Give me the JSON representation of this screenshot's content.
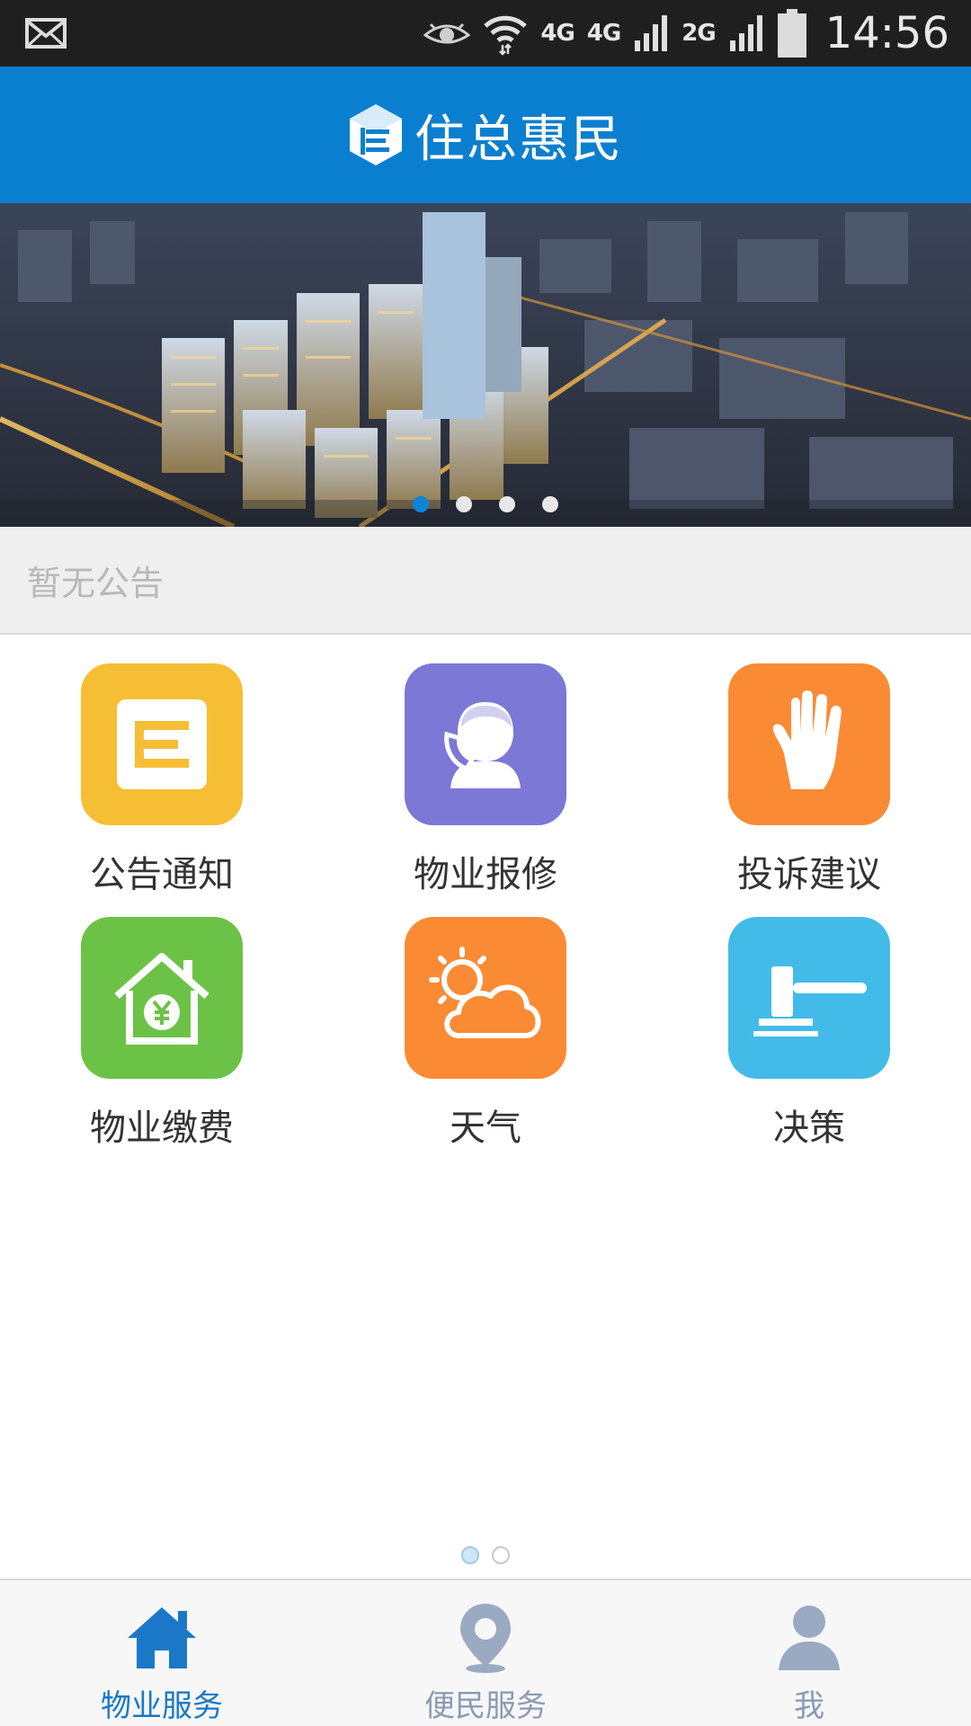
{
  "status_bar": {
    "mail_icon": "envelope-icon",
    "eye_icon": "eye-icon",
    "wifi_icon": "wifi-icon",
    "net_1": "4G",
    "net_2": "4G",
    "net_3": "2G",
    "time": "14:56"
  },
  "header": {
    "title": "住总惠民",
    "logo_icon": "cube-logo-icon",
    "background": "#0b7fcf"
  },
  "banner": {
    "image": "city-night-aerial-render",
    "dots_total": 4,
    "active_dot": 1
  },
  "notice": {
    "text": "暂无公告"
  },
  "services": [
    {
      "label": "公告通知",
      "icon": "notice-document-icon",
      "color": "#f6be35"
    },
    {
      "label": "物业报修",
      "icon": "phone-person-icon",
      "color": "#7b78d6"
    },
    {
      "label": "投诉建议",
      "icon": "raised-hand-icon",
      "color": "#fb8a35"
    },
    {
      "label": "物业缴费",
      "icon": "house-yuan-icon",
      "color": "#6cc246"
    },
    {
      "label": "天气",
      "icon": "sun-cloud-icon",
      "color": "#fb8a35"
    },
    {
      "label": "决策",
      "icon": "gavel-icon",
      "color": "#42bbe9"
    }
  ],
  "pager": {
    "total": 2,
    "active": 1
  },
  "bottom_nav": [
    {
      "label": "物业服务",
      "icon": "home-icon",
      "active": true
    },
    {
      "label": "便民服务",
      "icon": "location-pin-icon",
      "active": false
    },
    {
      "label": "我",
      "icon": "user-icon",
      "active": false
    }
  ],
  "colors": {
    "accent": "#0b7fcf",
    "nav_active": "#1b78c8",
    "nav_inactive": "#8a9bb4"
  }
}
